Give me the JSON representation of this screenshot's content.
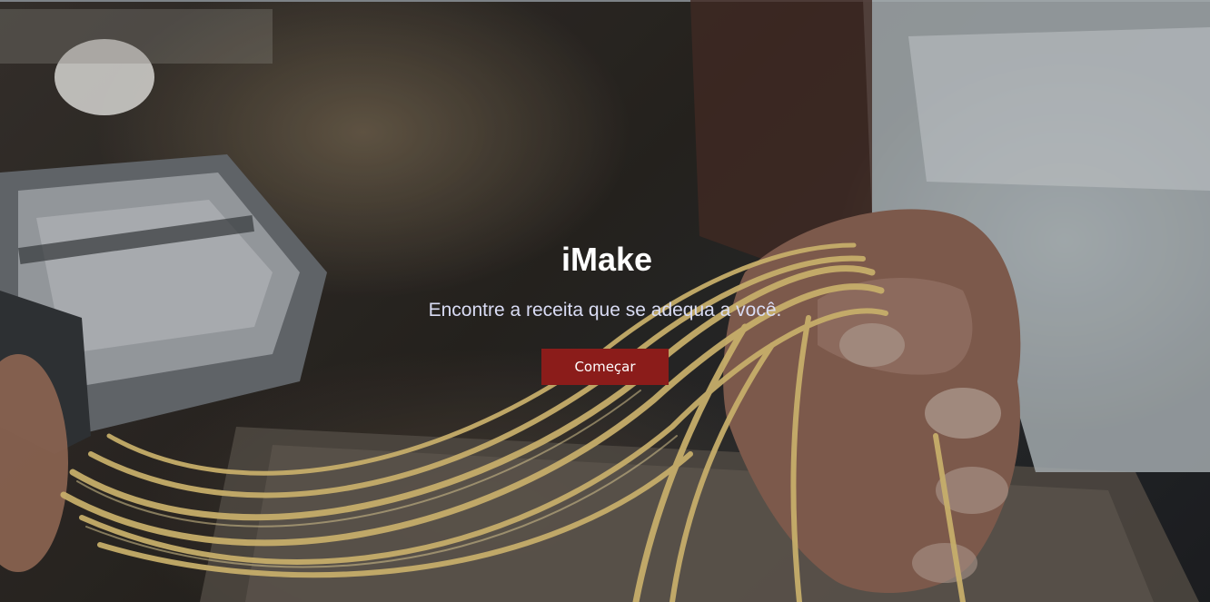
{
  "hero": {
    "background_image": "chef hands holding fresh pasta ribbons from a pasta machine",
    "title": "iMake",
    "subtitle": "Encontre a receita que se adequa a você.",
    "cta_label": "Começar"
  },
  "colors": {
    "title": "#ffffff",
    "subtitle": "#d9dcf4",
    "cta_background": "#8b1c1a",
    "cta_text": "#ffffff"
  }
}
